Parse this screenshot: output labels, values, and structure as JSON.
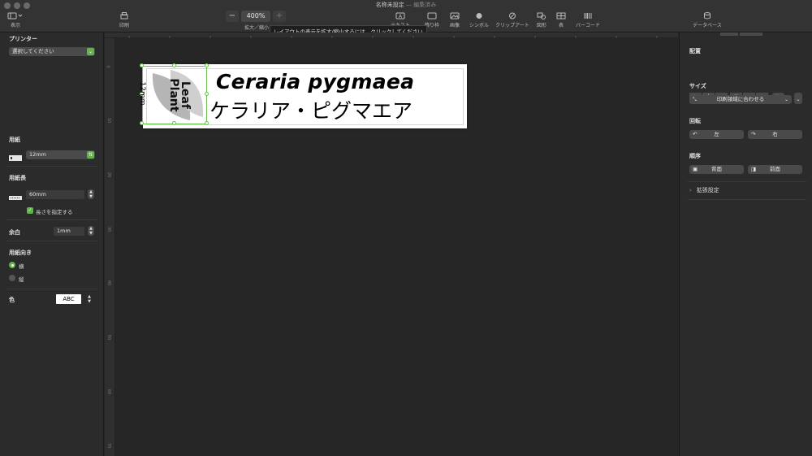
{
  "window": {
    "title": "名称未設定",
    "separator": "—",
    "status": "編集済み"
  },
  "toolbar": {
    "view_label": "表示",
    "print_label": "印刷",
    "zoom_value": "400%",
    "zoom_minus": "−",
    "zoom_plus": "+",
    "zoom_label": "拡大／縮小",
    "zoom_tooltip": "レイアウトの表示を拡大/縮小するには、クリックしてください",
    "text_label": "テキスト",
    "frame_label": "飾り枠",
    "image_label": "画像",
    "symbol_label": "シンボル",
    "clipart_label": "クリップアート",
    "shape_label": "図形",
    "table_label": "表",
    "barcode_label": "バーコード",
    "database_label": "データベース"
  },
  "left_panel": {
    "printer_title": "プリンター",
    "printer_select": "選択してください",
    "paper_title": "用紙",
    "paper_value": "12mm",
    "length_title": "用紙長",
    "length_value": "60mm",
    "length_fixed_label": "長さを指定する",
    "margin_title": "余白",
    "margin_value": "1mm",
    "orientation_title": "用紙向き",
    "orientation_landscape": "横",
    "orientation_portrait": "縦",
    "color_title": "色",
    "color_value": "ABC"
  },
  "canvas": {
    "tape_size": "12mm",
    "latin_name": "Ceraria pygmaea",
    "japanese_name": "ケラリア・ピグマエア",
    "logo_text": "Leaf Plant"
  },
  "right_panel": {
    "align_title": "配置",
    "size_title": "サイズ",
    "size_fit_label": "印刷領域に合わせる",
    "rotate_title": "回転",
    "rotate_left": "左",
    "rotate_right": "右",
    "order_title": "順序",
    "order_back": "背面",
    "order_front": "前面",
    "advanced_label": "拡張設定"
  },
  "ruler": {
    "marks": [
      "0",
      "10",
      "20",
      "30",
      "40",
      "50",
      "60",
      "70"
    ]
  },
  "colors": {
    "accent": "#5fb44a",
    "selection": "#6bbf4e"
  }
}
